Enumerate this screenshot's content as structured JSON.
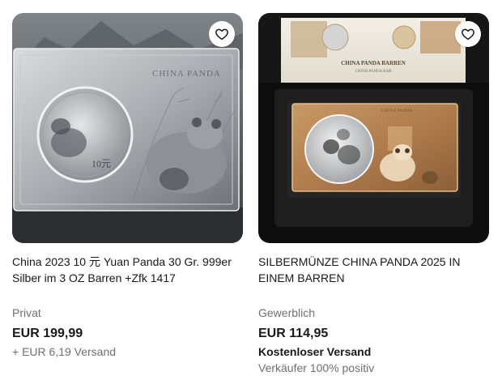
{
  "listings": [
    {
      "title": "China 2023 10 元 Yuan Panda 30 Gr. 999er Silber im 3 OZ Barren +Zfk 1417",
      "seller_type": "Privat",
      "price": "EUR 199,99",
      "shipping": "+ EUR 6,19 Versand",
      "image_text": "CHINA PANDA",
      "coin_text": "10元"
    },
    {
      "title": "SILBERMÜNZE CHINA PANDA 2025 IN EINEM BARREN",
      "seller_type": "Gewerblich",
      "price": "EUR 114,95",
      "shipping": "Kostenloser Versand",
      "seller_rating": "Verkäufer 100% positiv",
      "image_text": "CHINA PANDA BARREN",
      "image_subtext": "CHINA PANDA BAR",
      "bar_text": "CHINA PANDA"
    }
  ],
  "icons": {
    "favorite": "heart-outline-icon"
  },
  "colors": {
    "text_primary": "#191919",
    "text_secondary": "#707070",
    "card_bg": "#ffffff"
  }
}
